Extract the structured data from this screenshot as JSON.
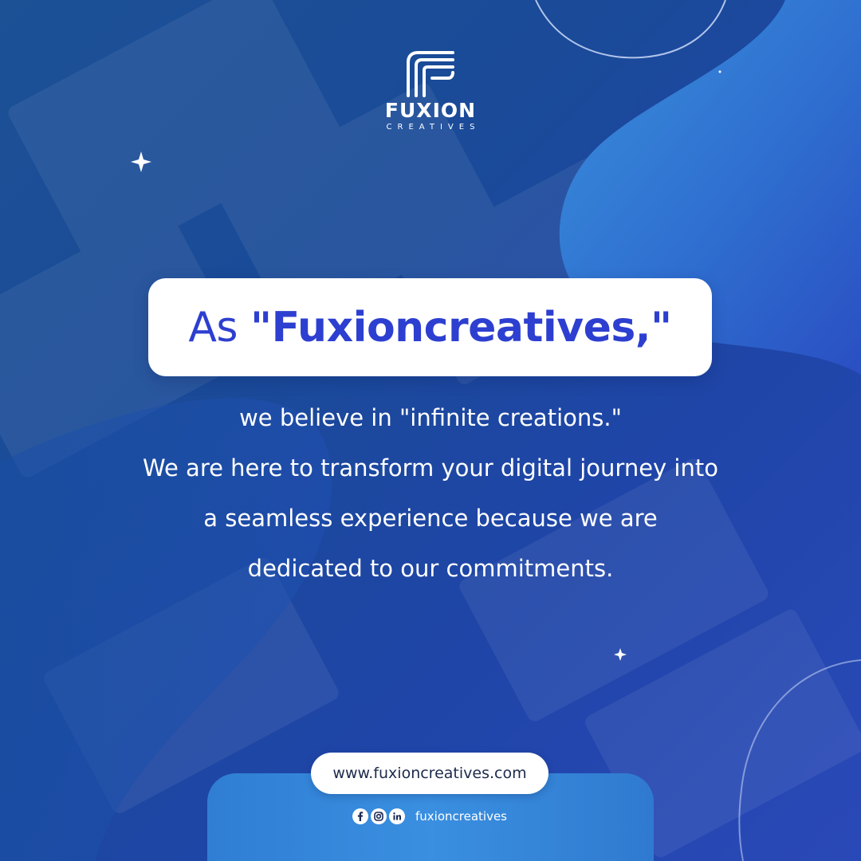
{
  "brand": {
    "name": "FUXION",
    "tagline": "CREATIVES"
  },
  "headline": {
    "prefix": "As ",
    "emphasis": "\"Fuxioncreatives,\""
  },
  "body": {
    "lines": [
      "we believe in \"infinite creations.\"",
      "We are here to transform your digital journey into",
      "a seamless experience because we are",
      "dedicated to our commitments."
    ]
  },
  "footer": {
    "website": "www.fuxioncreatives.com",
    "social_handle": "fuxioncreatives",
    "social_icons": [
      "facebook-icon",
      "instagram-icon",
      "linkedin-icon"
    ]
  },
  "colors": {
    "accent_blue": "#2d3fd0",
    "background_blue": "#1a4a98",
    "footer_blue": "#3a8fe0"
  }
}
